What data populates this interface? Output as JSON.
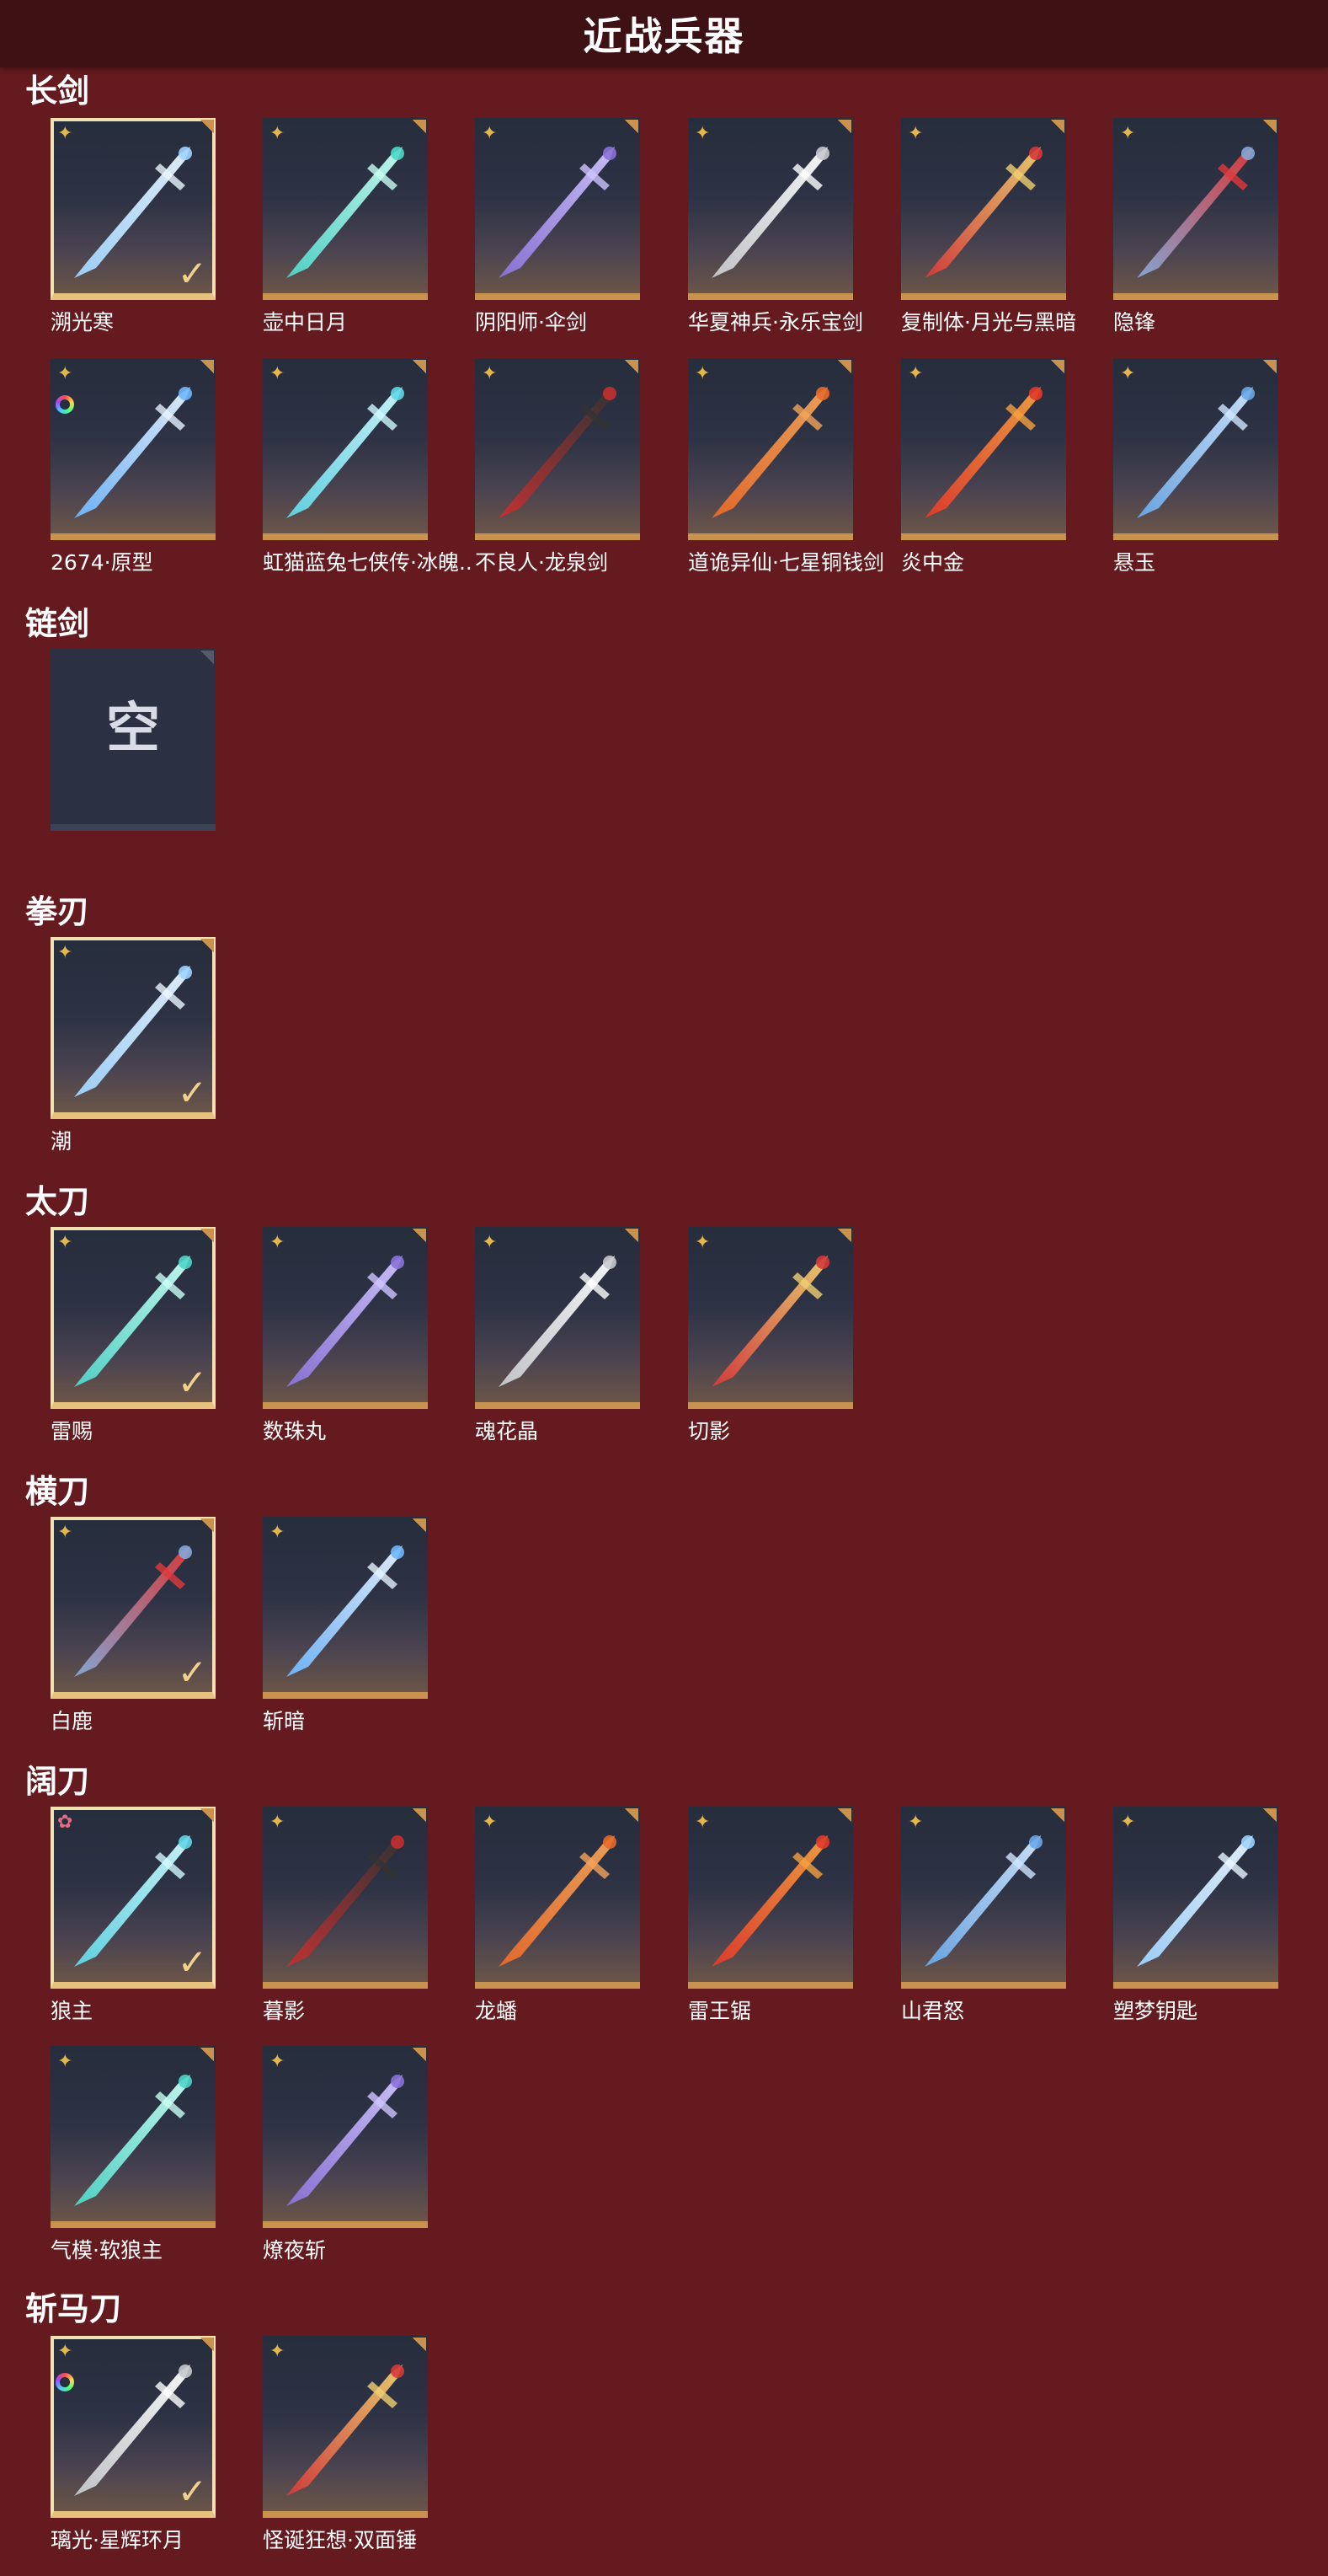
{
  "header": {
    "title": "近战兵器"
  },
  "sections": [
    {
      "title": "长剑",
      "items": [
        {
          "name": "溯光寒",
          "rarity": "✦",
          "selected": true
        },
        {
          "name": "壶中日月",
          "rarity": "✦"
        },
        {
          "name": "阴阳师·伞剑",
          "rarity": "✦"
        },
        {
          "name": "华夏神兵·永乐宝剑",
          "rarity": "✦"
        },
        {
          "name": "复制体·月光与黑暗",
          "rarity": "✦"
        },
        {
          "name": "隐锋",
          "rarity": "✦"
        },
        {
          "name": "2674·原型",
          "rarity": "✦",
          "skin": true
        },
        {
          "name": "虹猫蓝兔七侠传·冰魄..",
          "rarity": "✦"
        },
        {
          "name": "不良人·龙泉剑",
          "rarity": "✦"
        },
        {
          "name": "道诡异仙·七星铜钱剑",
          "rarity": "✦"
        },
        {
          "name": "炎中金",
          "rarity": "✦"
        },
        {
          "name": "悬玉",
          "rarity": "✦"
        }
      ]
    },
    {
      "title": "链剑",
      "empty_text": "空",
      "items": []
    },
    {
      "title": "拳刃",
      "items": [
        {
          "name": "潮",
          "rarity": "✦",
          "selected": true
        }
      ]
    },
    {
      "title": "太刀",
      "items": [
        {
          "name": "雷赐",
          "rarity": "✦",
          "selected": true
        },
        {
          "name": "数珠丸",
          "rarity": "✦"
        },
        {
          "name": "魂花晶",
          "rarity": "✦"
        },
        {
          "name": "切影",
          "rarity": "✦"
        }
      ]
    },
    {
      "title": "横刀",
      "items": [
        {
          "name": "白鹿",
          "rarity": "✦",
          "selected": true
        },
        {
          "name": "斩暗",
          "rarity": "✦"
        }
      ]
    },
    {
      "title": "阔刀",
      "items": [
        {
          "name": "狼主",
          "rarity": "✿",
          "rarity_color": "pink",
          "selected": true
        },
        {
          "name": "暮影",
          "rarity": "✦"
        },
        {
          "name": "龙蟠",
          "rarity": "✦"
        },
        {
          "name": "雷王锯",
          "rarity": "✦"
        },
        {
          "name": "山君怒",
          "rarity": "✦"
        },
        {
          "name": "塑梦钥匙",
          "rarity": "✦"
        },
        {
          "name": "气模·软狼主",
          "rarity": "✦"
        },
        {
          "name": "燎夜斩",
          "rarity": "✦"
        }
      ]
    },
    {
      "title": "斩马刀",
      "items": [
        {
          "name": "璃光·星辉环月",
          "rarity": "✦",
          "skin": true,
          "selected": true
        },
        {
          "name": "怪诞狂想·双面锤",
          "rarity": "✦"
        }
      ]
    }
  ],
  "check_glyph": "✓",
  "colors": {
    "background": "#641a1e",
    "header": "#3e1214",
    "card_border": "#c9924f",
    "selected_border": "#f2e0b0",
    "rarity_gold": "#e5b64a"
  }
}
